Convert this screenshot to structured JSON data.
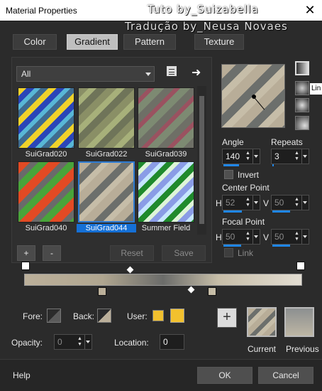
{
  "window": {
    "title": "Material Properties",
    "close_label": "✕"
  },
  "watermarks": [
    "Tuto by_Suizabella",
    "Tradução by_Neusa Novaes"
  ],
  "tabs": [
    {
      "label": "Color"
    },
    {
      "label": "Gradient"
    },
    {
      "label": "Pattern"
    },
    {
      "label": "Texture"
    }
  ],
  "category": {
    "value": "All"
  },
  "gradients": [
    {
      "name": "SuiGrad020"
    },
    {
      "name": "SuiGrad022"
    },
    {
      "name": "SuiGrad039"
    },
    {
      "name": "SuiGrad040"
    },
    {
      "name": "SuiGrad044"
    },
    {
      "name": "Summer Field"
    }
  ],
  "list_buttons": {
    "add": "+",
    "remove": "-",
    "reset": "Reset",
    "save": "Save"
  },
  "angle": {
    "label": "Angle",
    "value": "140"
  },
  "repeats": {
    "label": "Repeats",
    "value": "3"
  },
  "invert": {
    "label": "Invert"
  },
  "center_point": {
    "label": "Center Point",
    "h_label": "H",
    "h_value": "52",
    "v_label": "V",
    "v_value": "50"
  },
  "focal_point": {
    "label": "Focal Point",
    "h_label": "H",
    "h_value": "50",
    "v_label": "V",
    "v_value": "50"
  },
  "link": {
    "label": "Link"
  },
  "tooltip": {
    "text": "Lin"
  },
  "colors": {
    "fore_label": "Fore:",
    "back_label": "Back:",
    "user_label": "User:",
    "user_color": "#f2c12e"
  },
  "opacity": {
    "label": "Opacity:",
    "value": "0"
  },
  "location": {
    "label": "Location:",
    "value": "0"
  },
  "swatches": {
    "current_label": "Current",
    "previous_label": "Previous",
    "add_label": "+"
  },
  "footer": {
    "help": "Help",
    "ok": "OK",
    "cancel": "Cancel"
  }
}
